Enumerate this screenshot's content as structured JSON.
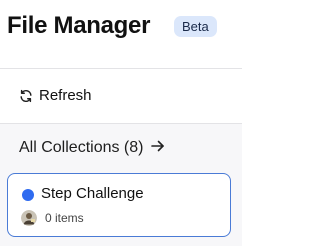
{
  "header": {
    "title": "File Manager",
    "badge": "Beta"
  },
  "toolbar": {
    "refresh_label": "Refresh",
    "refresh_icon": "refresh-icon"
  },
  "collections": {
    "heading": "All Collections (8)",
    "arrow_icon": "arrow-right-icon",
    "items": [
      {
        "name": "Step Challenge",
        "count_label": "0 items",
        "dot_color": "#2f6bf0",
        "avatar_icon": "user-avatar-icon"
      }
    ]
  },
  "colors": {
    "accent": "#4a7bd6",
    "badge_bg": "#dbe7fb"
  }
}
